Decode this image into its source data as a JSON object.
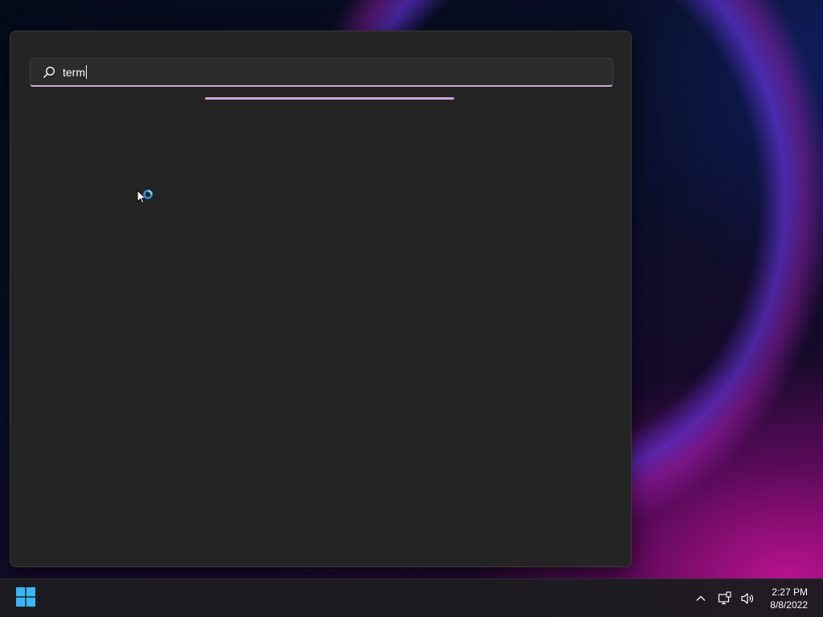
{
  "search": {
    "query": "term",
    "icon": "search-icon",
    "loading": true
  },
  "taskbar": {
    "start_icon": "windows-start-icon",
    "tray": {
      "overflow_icon": "chevron-up-icon",
      "network_icon": "network-icon",
      "volume_icon": "volume-icon"
    },
    "clock": {
      "time": "2:27 PM",
      "date": "8/8/2022"
    }
  },
  "colors": {
    "accent": "#d9a6e8",
    "start_blue": "#38b6f5",
    "panel_bg": "#242424"
  }
}
